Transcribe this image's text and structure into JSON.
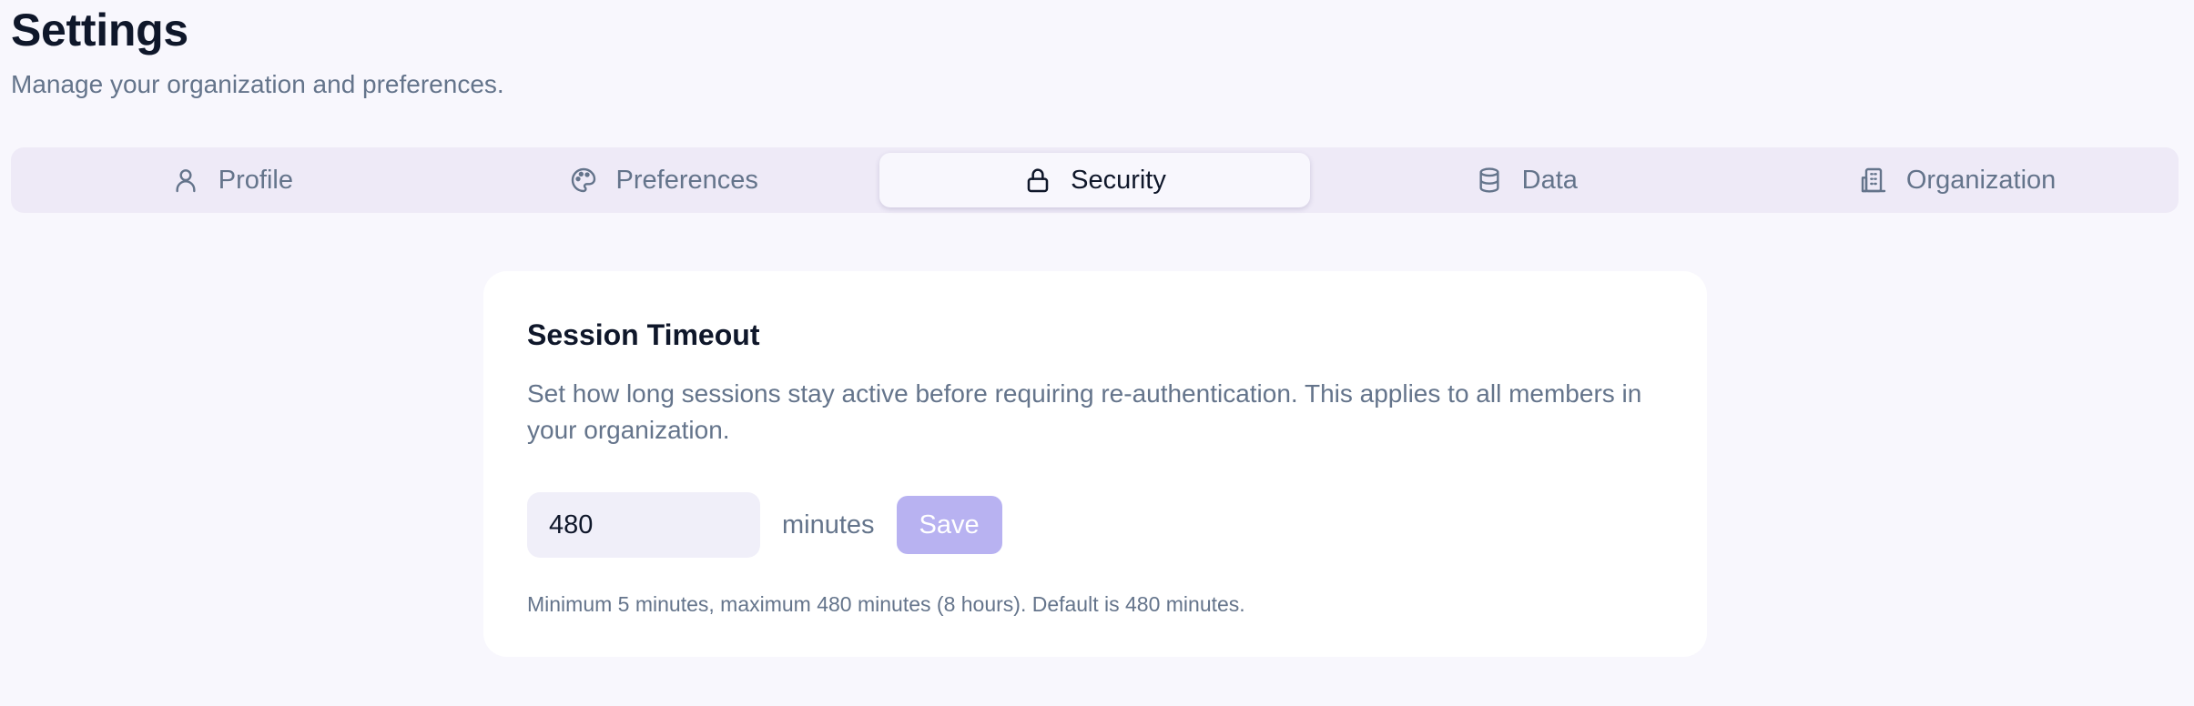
{
  "header": {
    "title": "Settings",
    "subtitle": "Manage your organization and preferences."
  },
  "tabs": [
    {
      "label": "Profile",
      "icon": "user-icon",
      "active": false
    },
    {
      "label": "Preferences",
      "icon": "palette-icon",
      "active": false
    },
    {
      "label": "Security",
      "icon": "lock-icon",
      "active": true
    },
    {
      "label": "Data",
      "icon": "database-icon",
      "active": false
    },
    {
      "label": "Organization",
      "icon": "building-icon",
      "active": false
    }
  ],
  "session": {
    "title": "Session Timeout",
    "description": "Set how long sessions stay active before requiring re-authentication. This applies to all members in your organization.",
    "value": "480",
    "unit": "minutes",
    "save_label": "Save",
    "hint": "Minimum 5 minutes, maximum 480 minutes (8 hours). Default is 480 minutes."
  },
  "colors": {
    "background": "#f8f7fd",
    "tab_bar": "#eeeaf7",
    "muted_text": "#64748b",
    "save_button_disabled": "#b8b2f1"
  }
}
